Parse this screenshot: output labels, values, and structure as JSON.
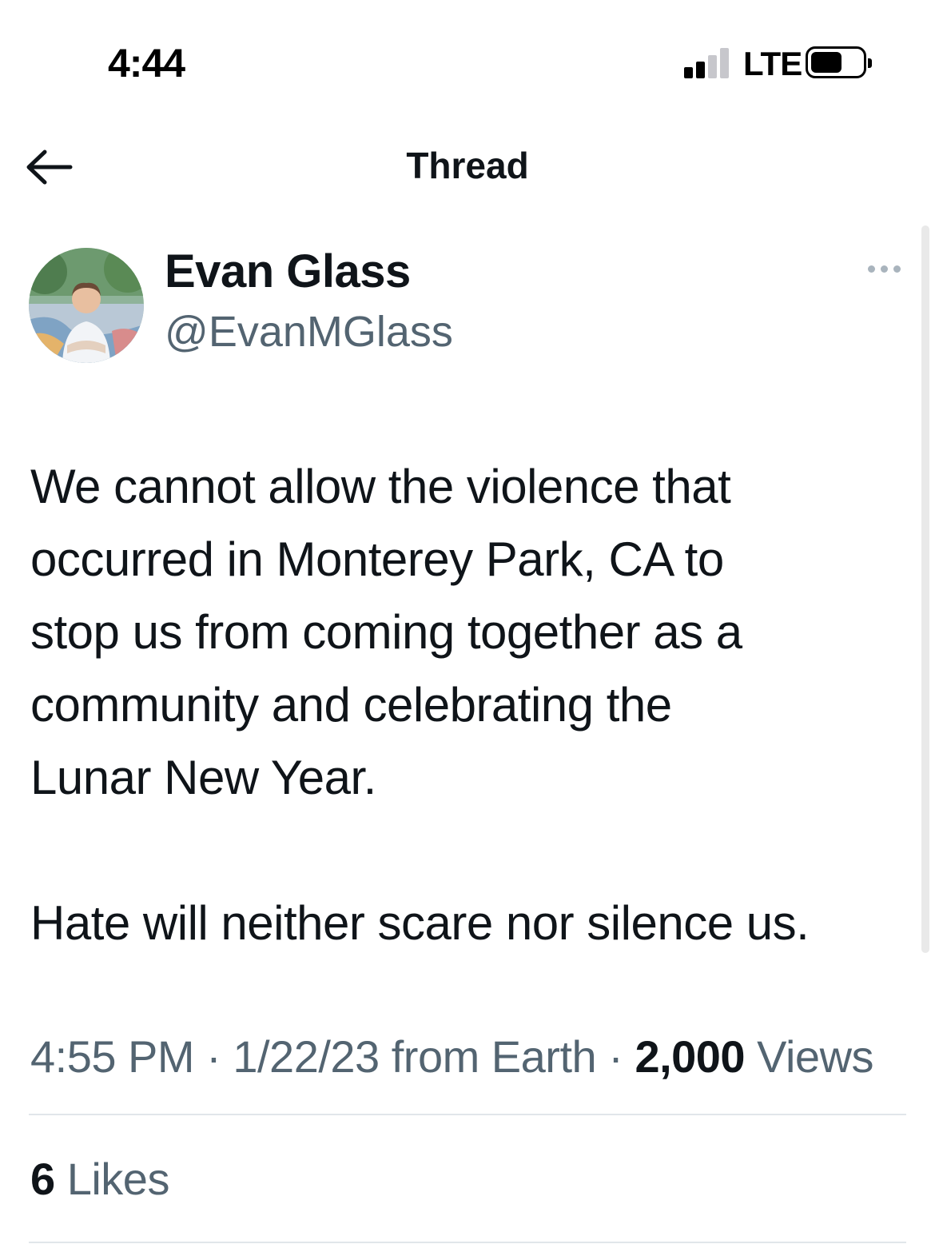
{
  "status_bar": {
    "time": "4:44",
    "network": "LTE"
  },
  "header": {
    "title": "Thread"
  },
  "author": {
    "name": "Evan Glass",
    "handle": "@EvanMGlass"
  },
  "tweet": {
    "lines": [
      "We cannot allow the violence that",
      "occurred in Monterey Park, CA to",
      "stop us from coming together as a",
      "community and celebrating the",
      "Lunar New Year."
    ],
    "closing": "Hate will neither scare nor silence us."
  },
  "meta": {
    "time": "4:55 PM",
    "separator": "·",
    "date": "1/22/23",
    "source": "from Earth",
    "views_count": "2,000",
    "views_label": "Views"
  },
  "engagement": {
    "likes_count": "6",
    "likes_label": "Likes"
  }
}
